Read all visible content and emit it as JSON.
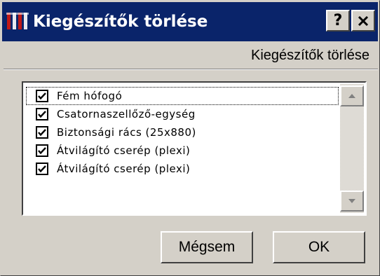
{
  "window": {
    "title": "Kiegészítők törlése",
    "help_button": "?",
    "close_button": "×"
  },
  "header": {
    "label": "Kiegészítők törlése"
  },
  "list": {
    "items": [
      {
        "label": "Fém hófogó",
        "checked": true
      },
      {
        "label": "Csatornaszellőző-egység",
        "checked": true
      },
      {
        "label": "Biztonsági rács (25x880)",
        "checked": true
      },
      {
        "label": "Átvilágító cserép (plexi)",
        "checked": true
      },
      {
        "label": "Átvilágító cserép (plexi)",
        "checked": true
      }
    ]
  },
  "buttons": {
    "cancel_label": "Mégsem",
    "ok_label": "OK"
  },
  "icons": {
    "title": "app-icon",
    "help": "help-icon",
    "close": "close-icon",
    "check": "check-icon",
    "scroll_up": "arrow-up-icon",
    "scroll_down": "arrow-down-icon"
  },
  "colors": {
    "titlebar": "#0a246a",
    "face": "#d4d0c8"
  }
}
